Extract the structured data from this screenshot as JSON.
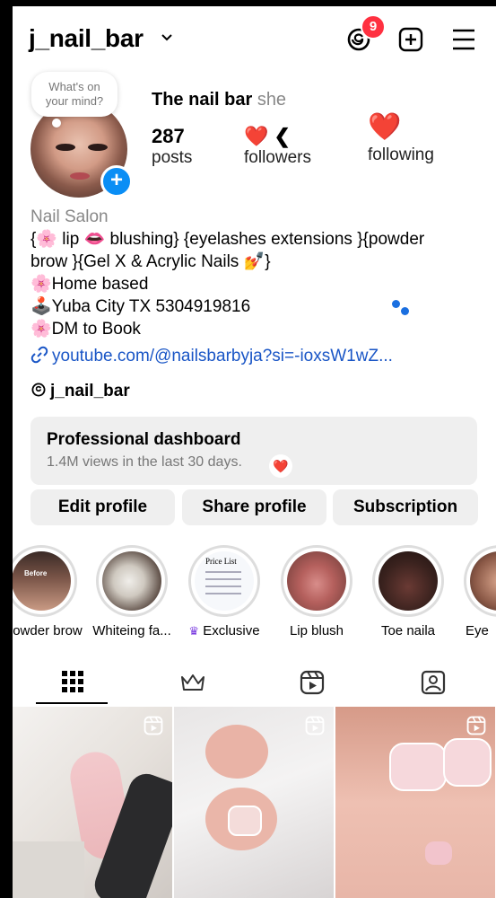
{
  "header": {
    "username": "j_nail_bar",
    "threads_badge_count": "9"
  },
  "profile": {
    "bubble_text_line1": "What's on",
    "bubble_text_line2": "your mind?",
    "full_name": "The nail bar",
    "pronoun": "she",
    "posts_count": "287",
    "posts_label": "posts",
    "followers_count": "❤️ ❮",
    "followers_label": "followers",
    "following_count": "❤️",
    "following_label": "following"
  },
  "bio": {
    "category": "Nail Salon",
    "line1": "{🌸 lip 👄 blushing} {eyelashes extensions }{powder",
    "line2": "brow }{Gel X & Acrylic Nails 💅}",
    "line3": "🌸Home based",
    "line4": "🕹️Yuba City TX 5304919816",
    "line5": "🌸DM to Book",
    "link": "youtube.com/@nailsbarbyja?si=-ioxsW1wZ...",
    "threads_handle": "j_nail_bar"
  },
  "dashboard": {
    "title": "Professional dashboard",
    "subtitle": "1.4M views in the last 30 days."
  },
  "buttons": {
    "edit": "Edit profile",
    "share": "Share profile",
    "subscription": "Subscription"
  },
  "highlights": [
    {
      "label": "owder brow"
    },
    {
      "label": "Whiteing fa..."
    },
    {
      "label": "Exclusive"
    },
    {
      "label": "Lip blush"
    },
    {
      "label": "Toe naila"
    },
    {
      "label": "Eye"
    }
  ],
  "highlight_texts": {
    "before": "Before",
    "price_list": "Price List"
  },
  "colors": {
    "accent_blue": "#0a8ef5",
    "badge_red": "#ff3040",
    "link_blue": "#1a56c6",
    "button_gray": "#efefef",
    "exclusive_purple": "#7a3be0"
  },
  "icons": [
    "threads-icon",
    "new-post-icon",
    "menu-icon",
    "link-icon",
    "grid-icon",
    "crown-icon",
    "reels-icon",
    "tagged-icon"
  ]
}
